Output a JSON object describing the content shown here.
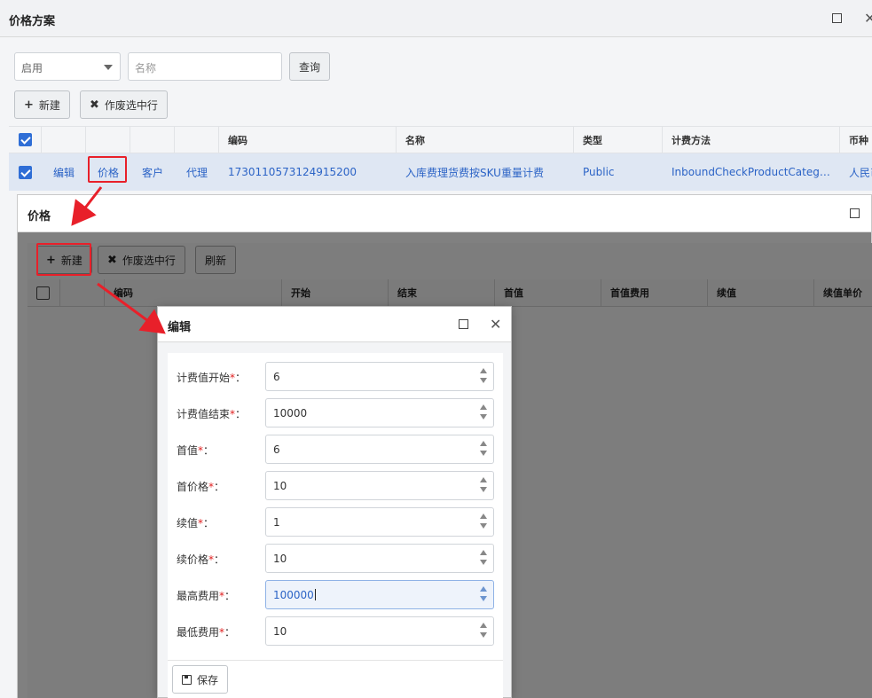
{
  "main_window": {
    "title": "价格方案",
    "status_filter": "启用",
    "name_placeholder": "名称",
    "query_label": "查询",
    "new_label": "新建",
    "void_label": "作废选中行",
    "columns": [
      "编码",
      "名称",
      "类型",
      "计费方法",
      "币种"
    ],
    "row": {
      "edit": "编辑",
      "price": "价格",
      "customer": "客户",
      "agent": "代理",
      "code": "1730110573124915200",
      "name": "入库费理货费按SKU重量计费",
      "type": "Public",
      "method": "InboundCheckProductCateg…",
      "currency": "人民币"
    }
  },
  "price_window": {
    "title": "价格",
    "new_label": "新建",
    "void_label": "作废选中行",
    "refresh_label": "刷新",
    "columns": [
      "编码",
      "开始",
      "结束",
      "首值",
      "首值费用",
      "续值",
      "续值单价"
    ]
  },
  "edit_dialog": {
    "title": "编辑",
    "fields": [
      {
        "label": "计费值开始",
        "value": "6"
      },
      {
        "label": "计费值结束",
        "value": "10000"
      },
      {
        "label": "首值",
        "value": "6"
      },
      {
        "label": "首价格",
        "value": "10"
      },
      {
        "label": "续值",
        "value": "1"
      },
      {
        "label": "续价格",
        "value": "10"
      },
      {
        "label": "最高费用",
        "value": "100000"
      },
      {
        "label": "最低费用",
        "value": "10"
      }
    ],
    "required_mark": "*",
    "colon": "：",
    "save_label": "保存"
  },
  "colors": {
    "annotation_red": "#e8202a",
    "link_blue": "#2b63c6",
    "checkbox_blue": "#2f6ed6"
  }
}
